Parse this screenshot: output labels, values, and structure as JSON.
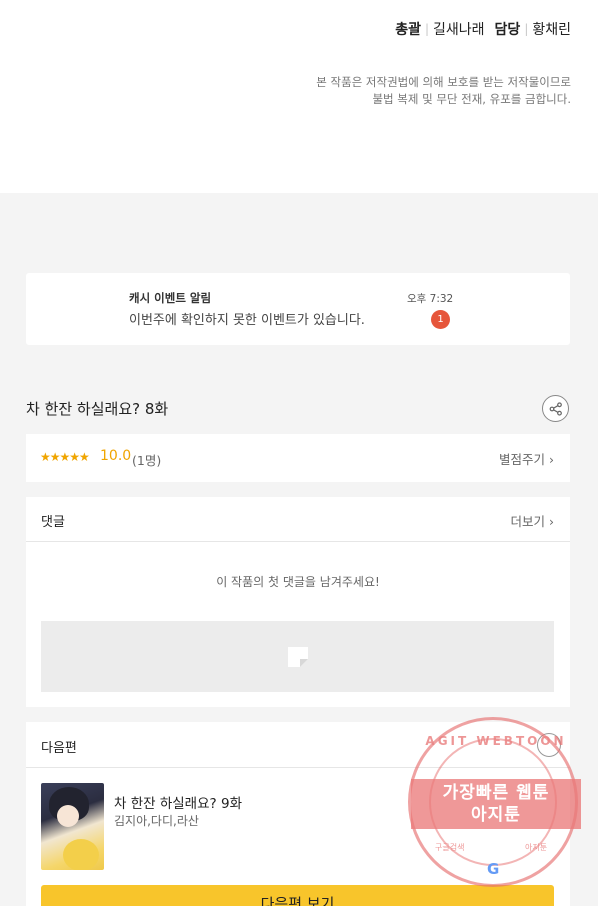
{
  "credits": {
    "art_role": "총괄",
    "art_name": "길새나래",
    "story_role": "담당",
    "story_name": "황채린"
  },
  "copyright": {
    "line1": "본 작품은 저작권법에 의해 보호를 받는 저작물이므로",
    "line2": "불법 복제 및 무단 전재, 유포를 금합니다."
  },
  "notification": {
    "title": "캐시 이벤트 알림",
    "message": "이번주에 확인하지 못한 이벤트가 있습니다.",
    "time": "오후 7:32",
    "badge": "1"
  },
  "episode": {
    "title": "차 한잔 하실래요? 8화"
  },
  "rating": {
    "stars": "★★★★★",
    "score": "10.0",
    "count": "(1명)",
    "rate_label": "별점주기 ›"
  },
  "comments": {
    "label": "댓글",
    "more_label": "더보기 ›",
    "empty_text": "이 작품의 첫 댓글을 남겨주세요!"
  },
  "next_episode": {
    "label": "다음편",
    "title": "차 한잔 하실래요? 9화",
    "authors": "김지아,다디,라산",
    "button_label": "다음편 보기"
  },
  "watermark": {
    "arc_text": "AGIT WEBTOON",
    "line1": "가장빠른 웹툰",
    "line2": "아지툰",
    "small_left": "구글검색",
    "small_right": "아지툰",
    "g": "G"
  }
}
